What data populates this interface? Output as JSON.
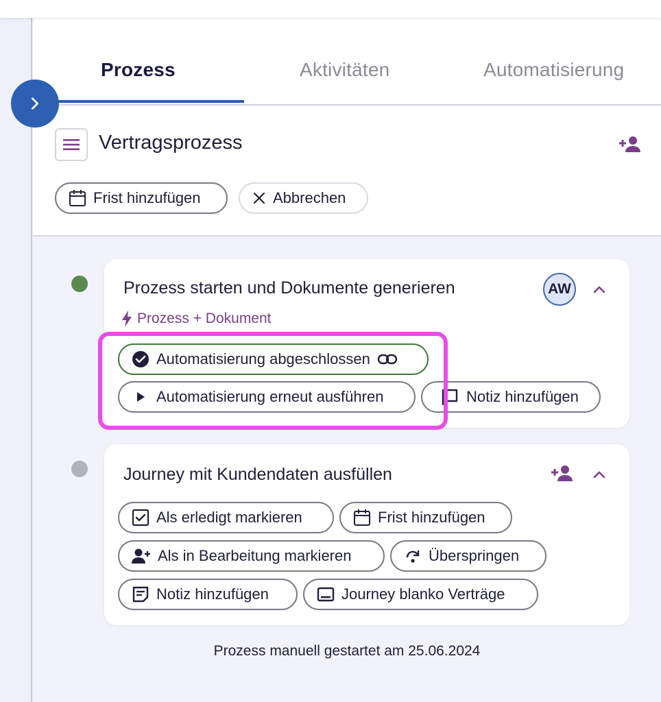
{
  "tabs": [
    {
      "label": "Prozess",
      "active": true
    },
    {
      "label": "Aktivitäten",
      "active": false
    },
    {
      "label": "Automatisierung",
      "active": false
    }
  ],
  "process": {
    "title": "Vertragsprozess",
    "actions": {
      "deadline": "Frist hinzufügen",
      "cancel": "Abbrechen"
    }
  },
  "steps": [
    {
      "title": "Prozess starten und Dokumente generieren",
      "status_color": "#5a8a4e",
      "tag": "Prozess + Dokument",
      "avatar": "AW",
      "actions": {
        "completed": "Automatisierung abgeschlossen",
        "rerun": "Automatisierung erneut ausführen",
        "note": "Notiz hinzufügen"
      }
    },
    {
      "title": "Journey mit Kundendaten ausfüllen",
      "status_color": "#b2b2bb",
      "actions": {
        "mark_done": "Als erledigt markieren",
        "deadline": "Frist hinzufügen",
        "mark_in_progress": "Als in Bearbeitung markieren",
        "skip": "Überspringen",
        "note": "Notiz hinzufügen",
        "journey": "Journey blanko Verträge"
      }
    }
  ],
  "footer": "Prozess manuell gestartet am 25.06.2024",
  "colors": {
    "accent": "#2d5fb2",
    "purple": "#7b3f8a",
    "highlight": "#e64de9",
    "success": "#3f7a3a"
  }
}
